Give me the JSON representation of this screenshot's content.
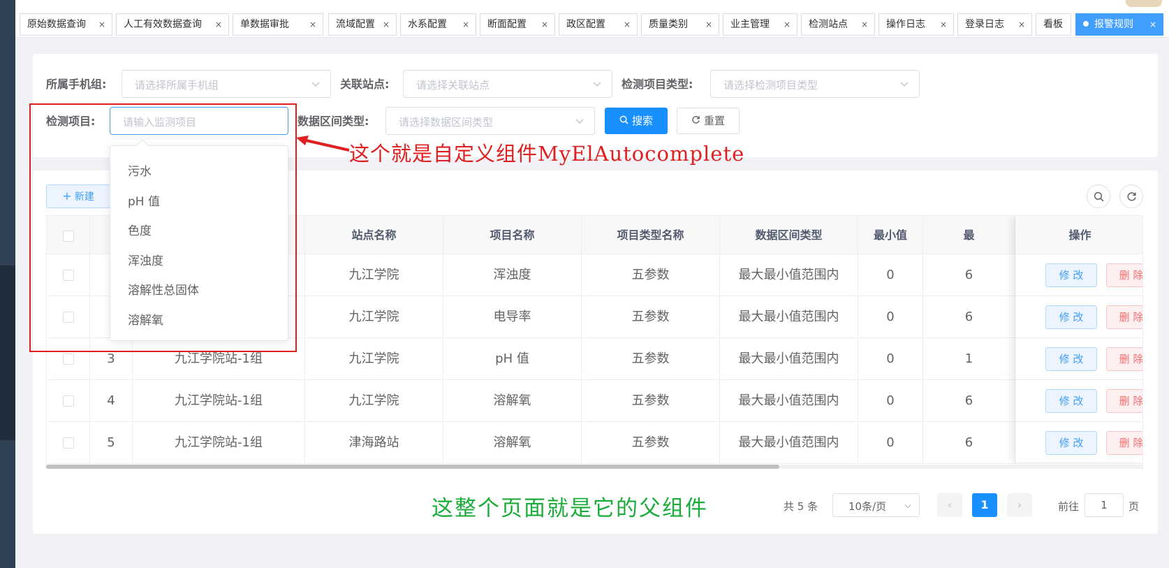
{
  "tags": [
    {
      "label": "原始数据查询",
      "closable": true
    },
    {
      "label": "人工有效数据查询",
      "closable": true
    },
    {
      "label": "单数据审批",
      "closable": true
    },
    {
      "label": "流域配置",
      "closable": true
    },
    {
      "label": "水系配置",
      "closable": true
    },
    {
      "label": "断面配置",
      "closable": true
    },
    {
      "label": "政区配置",
      "closable": true
    },
    {
      "label": "质量类别",
      "closable": true
    },
    {
      "label": "业主管理",
      "closable": true
    },
    {
      "label": "检测站点",
      "closable": true
    },
    {
      "label": "操作日志",
      "closable": true
    },
    {
      "label": "登录日志",
      "closable": true
    },
    {
      "label": "看板",
      "closable": false
    },
    {
      "label": "报警规则",
      "closable": true,
      "active": true
    }
  ],
  "search": {
    "phone_group": {
      "label": "所属手机组:",
      "placeholder": "请选择所属手机组"
    },
    "station": {
      "label": "关联站点:",
      "placeholder": "请选择关联站点"
    },
    "item_type": {
      "label": "检测项目类型:",
      "placeholder": "请选择检测项目类型"
    },
    "item": {
      "label": "检测项目:",
      "placeholder": "请输入监测项目"
    },
    "range_type": {
      "label": "数据区间类型:",
      "placeholder": "请选择数据区间类型"
    },
    "search_button": "搜索",
    "reset_button": "重置"
  },
  "autocomplete_options": [
    "污水",
    "pH 值",
    "色度",
    "浑浊度",
    "溶解性总固体",
    "溶解氧"
  ],
  "annotations": {
    "component_note": "这个就是自定义组件MyElAutocomplete",
    "parent_note": "这整个页面就是它的父组件"
  },
  "toolbar": {
    "new_button": "新建"
  },
  "table": {
    "headers": [
      "",
      "",
      "",
      "站点名称",
      "项目名称",
      "项目类型名称",
      "数据区间类型",
      "最小值",
      "最"
    ],
    "operation_header": "操作",
    "rows": [
      {
        "index": "",
        "group": "",
        "station": "九江学院",
        "item": "浑浊度",
        "item_type": "五参数",
        "range_type": "最大最小值范围内",
        "min": "0",
        "max": "6"
      },
      {
        "index": "",
        "group": "",
        "station": "九江学院",
        "item": "电导率",
        "item_type": "五参数",
        "range_type": "最大最小值范围内",
        "min": "0",
        "max": "6"
      },
      {
        "index": "3",
        "group": "九江学院站-1组",
        "station": "九江学院",
        "item": "pH 值",
        "item_type": "五参数",
        "range_type": "最大最小值范围内",
        "min": "0",
        "max": "1"
      },
      {
        "index": "4",
        "group": "九江学院站-1组",
        "station": "九江学院",
        "item": "溶解氧",
        "item_type": "五参数",
        "range_type": "最大最小值范围内",
        "min": "0",
        "max": "6"
      },
      {
        "index": "5",
        "group": "九江学院站-1组",
        "station": "津海路站",
        "item": "溶解氧",
        "item_type": "五参数",
        "range_type": "最大最小值范围内",
        "min": "0",
        "max": "6"
      }
    ],
    "edit_label": "修 改",
    "delete_label": "删 除"
  },
  "pagination": {
    "total_text": "共 5 条",
    "page_size": "10条/页",
    "current_page": "1",
    "goto_label": "前往",
    "goto_value": "1",
    "page_unit": "页"
  },
  "colors": {
    "primary": "#1890ff",
    "danger": "#f56c6c",
    "annotation_red": "#e02020",
    "annotation_green": "#1aad3a"
  }
}
